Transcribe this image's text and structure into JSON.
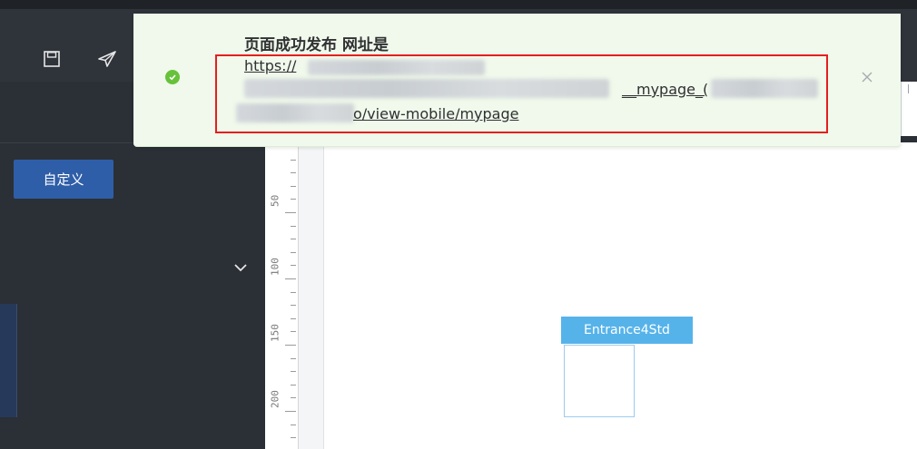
{
  "toolbar": {
    "icons": [
      "save-icon",
      "send-icon"
    ]
  },
  "left_panel": {
    "custom_button_label": "自定义",
    "collapse_icon": "chevron-down-icon"
  },
  "ruler": {
    "labels": [
      "50",
      "100",
      "150",
      "200"
    ]
  },
  "canvas": {
    "widget_label": "Entrance4Std"
  },
  "toast": {
    "status_icon": "check-circle-icon",
    "title": "页面成功发布 网址是",
    "url_line1": "https://",
    "url_line2": "__mypage_(",
    "url_line3": "o/view-mobile/mypage",
    "close_icon": "close-icon",
    "colors": {
      "background": "#f0f9eb",
      "success": "#67c23a",
      "highlight_border": "#e61e1e"
    }
  }
}
